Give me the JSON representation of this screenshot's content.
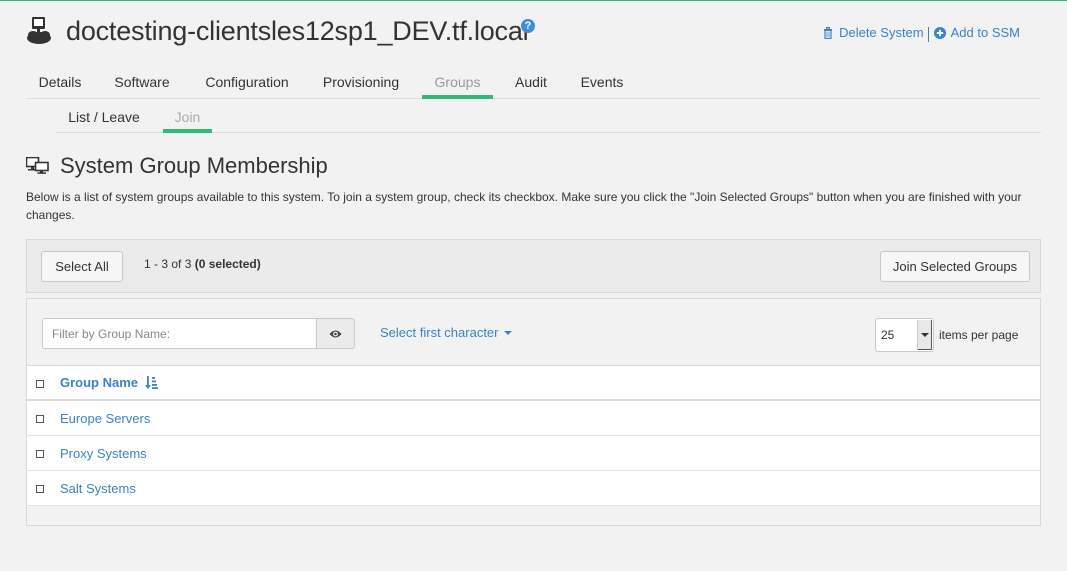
{
  "header": {
    "title": "doctesting-clientsles12sp1_DEV.tf.local",
    "help_glyph": "?",
    "delete_label": "Delete System",
    "ssm_label": "Add to SSM"
  },
  "tabs": [
    {
      "label": "Details",
      "active": false
    },
    {
      "label": "Software",
      "active": false
    },
    {
      "label": "Configuration",
      "active": false
    },
    {
      "label": "Provisioning",
      "active": false
    },
    {
      "label": "Groups",
      "active": true
    },
    {
      "label": "Audit",
      "active": false
    },
    {
      "label": "Events",
      "active": false
    }
  ],
  "subtabs": [
    {
      "label": "List / Leave",
      "active": false
    },
    {
      "label": "Join",
      "active": true
    }
  ],
  "section": {
    "title": "System Group Membership",
    "description": "Below is a list of system groups available to this system. To join a system group, check its checkbox. Make sure you click the \"Join Selected Groups\" button when you are finished with your changes."
  },
  "toolbar": {
    "select_all_label": "Select All",
    "count_range": "1 - 3 of 3",
    "count_selected": "(0 selected)",
    "join_label": "Join Selected Groups"
  },
  "filter": {
    "placeholder": "Filter by Group Name:",
    "first_char_label": "Select first character",
    "per_page_value": "25",
    "per_page_label": "items per page"
  },
  "table": {
    "column_header": "Group Name",
    "rows": [
      {
        "name": "Europe Servers",
        "checked": false
      },
      {
        "name": "Proxy Systems",
        "checked": false
      },
      {
        "name": "Salt Systems",
        "checked": false
      }
    ]
  },
  "colors": {
    "accent_green": "#30ba78",
    "link_blue": "#3b83c4",
    "help_blue": "#3b8fd6"
  },
  "icons": {
    "system": "system-icon",
    "help": "help-icon",
    "trash": "trash-icon",
    "add": "plus-circle-icon",
    "section": "monitors-icon",
    "eye": "eye-icon",
    "sort": "sort-alpha-icon"
  }
}
